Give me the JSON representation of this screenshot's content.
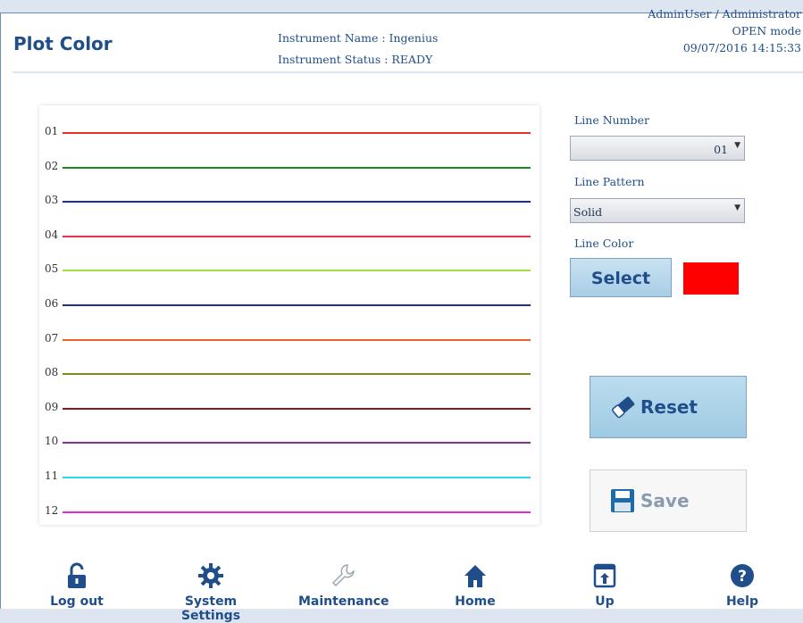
{
  "header": {
    "title": "Plot Color",
    "instrument_name": "Instrument Name : Ingenius",
    "instrument_status": "Instrument Status : READY",
    "user": "AdminUser / Administrator",
    "mode": "OPEN mode",
    "datetime": "09/07/2016 14:15:33"
  },
  "plot": {
    "lines": [
      {
        "label": "01",
        "color": "#e8302a"
      },
      {
        "label": "02",
        "color": "#1a8a1a"
      },
      {
        "label": "03",
        "color": "#1a2aa8"
      },
      {
        "label": "04",
        "color": "#e8344a"
      },
      {
        "label": "05",
        "color": "#9be03c"
      },
      {
        "label": "06",
        "color": "#1f2e8e"
      },
      {
        "label": "07",
        "color": "#f0602a"
      },
      {
        "label": "08",
        "color": "#808a1a"
      },
      {
        "label": "09",
        "color": "#8a1a1a"
      },
      {
        "label": "10",
        "color": "#8a2aa0"
      },
      {
        "label": "11",
        "color": "#2ad8e8"
      },
      {
        "label": "12",
        "color": "#e02ad8"
      }
    ]
  },
  "controls": {
    "line_number_label": "Line Number",
    "line_number_value": "01",
    "line_pattern_label": "Line Pattern",
    "line_pattern_value": "Solid",
    "line_color_label": "Line Color",
    "select_label": "Select",
    "selected_color": "#ff0000",
    "reset_label": "Reset",
    "save_label": "Save"
  },
  "footer": {
    "logout": "Log out",
    "system_settings": "System Settings",
    "maintenance": "Maintenance",
    "home": "Home",
    "up": "Up",
    "help": "Help"
  },
  "icons": {
    "logout": "unlocked-padlock-icon",
    "system_settings": "gear-icon",
    "maintenance": "wrench-icon",
    "home": "home-icon",
    "up": "window-up-arrow-icon",
    "help": "question-circle-icon",
    "reset": "eraser-icon",
    "save": "floppy-disk-icon"
  }
}
